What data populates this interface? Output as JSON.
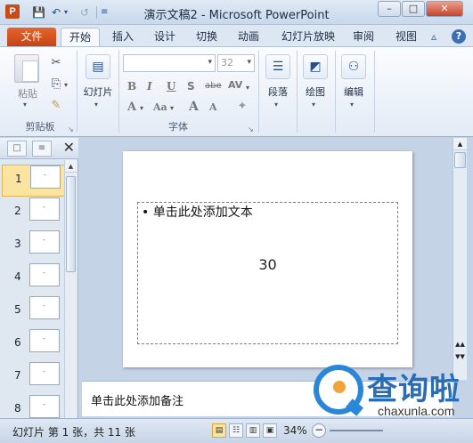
{
  "window": {
    "title": "演示文稿2 - Microsoft PowerPoint",
    "app_icon_letter": "P"
  },
  "ribbon_tabs": {
    "file": "文件",
    "items": [
      "开始",
      "插入",
      "设计",
      "切换",
      "动画",
      "幻灯片放映",
      "审阅",
      "视图"
    ],
    "active": "开始"
  },
  "ribbon": {
    "clipboard": {
      "paste_label": "粘贴",
      "group_label": "剪贴板"
    },
    "slides": {
      "label": "幻灯片"
    },
    "font": {
      "size_value": "32",
      "group_label": "字体",
      "buttons": [
        "B",
        "I",
        "U",
        "S",
        "abe",
        "AV",
        "A",
        "Aa",
        "A",
        "A"
      ]
    },
    "paragraph": {
      "label": "段落"
    },
    "drawing": {
      "label": "绘图"
    },
    "editing": {
      "label": "编辑"
    }
  },
  "slide_panel": {
    "thumbnails": [
      {
        "number": "1",
        "selected": true
      },
      {
        "number": "2",
        "selected": false
      },
      {
        "number": "3",
        "selected": false
      },
      {
        "number": "4",
        "selected": false
      },
      {
        "number": "5",
        "selected": false
      },
      {
        "number": "6",
        "selected": false
      },
      {
        "number": "7",
        "selected": false
      },
      {
        "number": "8",
        "selected": false
      }
    ]
  },
  "slide": {
    "placeholder_text": "• 单击此处添加文本",
    "center_text": "30"
  },
  "notes": {
    "placeholder": "单击此处添加备注"
  },
  "status": {
    "slide_info": "幻灯片 第 1 张，共 11 张",
    "zoom": "34%"
  },
  "watermark": {
    "cn": "查询啦",
    "en": "chaxunla.com"
  }
}
